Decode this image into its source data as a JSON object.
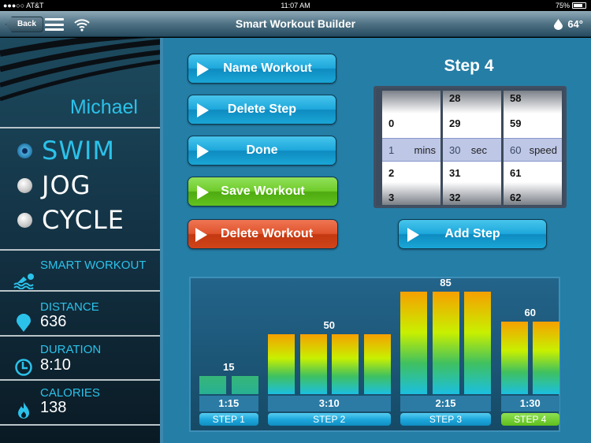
{
  "statusbar": {
    "carrier": "●●●○○ AT&T",
    "time": "11:07 AM",
    "battery": "75%",
    "battery_level": 0.75
  },
  "navbar": {
    "back_label": "Back",
    "title": "Smart Workout Builder",
    "temperature": "64°"
  },
  "sidebar": {
    "user_name": "Michael",
    "modes": [
      {
        "label": "SWIM",
        "selected": true
      },
      {
        "label": "JOG",
        "selected": false
      },
      {
        "label": "CYCLE",
        "selected": false
      }
    ],
    "stats": [
      {
        "label": "SMART WORKOUT",
        "value": "",
        "icon": "swimmer-icon"
      },
      {
        "label": "DISTANCE",
        "value": "636",
        "icon": "location-pin-icon"
      },
      {
        "label": "DURATION",
        "value": "8:10",
        "icon": "clock-icon"
      },
      {
        "label": "CALORIES",
        "value": "138",
        "icon": "flame-icon"
      }
    ]
  },
  "buttons": {
    "name_workout": "Name Workout",
    "delete_step": "Delete Step",
    "done": "Done",
    "save_workout": "Save Workout",
    "delete_workout": "Delete Workout",
    "add_step": "Add Step"
  },
  "step_title": "Step 4",
  "picker": {
    "mins": {
      "above": [
        "",
        "0"
      ],
      "selected": "1",
      "unit": "mins",
      "below": [
        "2",
        "3"
      ]
    },
    "sec": {
      "above": [
        "28",
        "29"
      ],
      "selected": "30",
      "unit": "sec",
      "below": [
        "31",
        "32"
      ]
    },
    "speed": {
      "above": [
        "58",
        "59"
      ],
      "selected": "60",
      "unit": "speed",
      "below": [
        "61",
        "62"
      ]
    }
  },
  "chart_data": {
    "type": "bar",
    "title": "",
    "ylim": [
      0,
      100
    ],
    "steps": [
      {
        "label": "STEP 1",
        "duration": "1:15",
        "value": 15,
        "bars": 2,
        "selected": false
      },
      {
        "label": "STEP 2",
        "duration": "3:10",
        "value": 50,
        "bars": 4,
        "selected": false
      },
      {
        "label": "STEP 3",
        "duration": "2:15",
        "value": 85,
        "bars": 3,
        "selected": false
      },
      {
        "label": "STEP 4",
        "duration": "1:30",
        "value": 60,
        "bars": 2,
        "selected": true
      }
    ]
  }
}
